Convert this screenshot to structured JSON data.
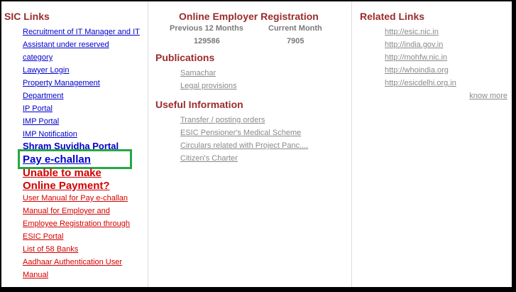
{
  "sic_links": {
    "heading": "SIC Links",
    "lines": [
      {
        "text": "Recruitment of IT Manager and IT",
        "style": "blue"
      },
      {
        "text": "Assistant under reserved",
        "style": "blue"
      },
      {
        "text": "category",
        "style": "blue"
      },
      {
        "text": "Lawyer Login",
        "style": "blue"
      },
      {
        "text": "Property Management",
        "style": "blue"
      },
      {
        "text": "Department",
        "style": "blue"
      },
      {
        "text": "IP Portal",
        "style": "blue"
      },
      {
        "text": "IMP Portal",
        "style": "blue"
      },
      {
        "text": "IMP Notification",
        "style": "blue"
      },
      {
        "text": "Shram Suvidha Portal",
        "style": "big-blue"
      },
      {
        "text": "Pay e-challan",
        "style": "pay"
      },
      {
        "text": "Unable to make",
        "style": "big-red"
      },
      {
        "text": "Online Payment?",
        "style": "big-red"
      },
      {
        "text": "User Manual for Pay e-challan",
        "style": "red"
      },
      {
        "text": "Manual for Employer and",
        "style": "red"
      },
      {
        "text": "Employee Registration through",
        "style": "red"
      },
      {
        "text": "ESIC Portal",
        "style": "red"
      },
      {
        "text": "List of 58 Banks",
        "style": "red"
      },
      {
        "text": "Aadhaar Authentication User",
        "style": "red"
      },
      {
        "text": "Manual",
        "style": "red"
      }
    ]
  },
  "employer_registration": {
    "heading": "Online Employer Registration",
    "prev_label": "Previous 12 Months",
    "curr_label": "Current Month",
    "prev_value": "129586",
    "curr_value": "7905"
  },
  "publications": {
    "heading": "Publications",
    "items": [
      "Samachar",
      "Legal provisions"
    ]
  },
  "useful_info": {
    "heading": "Useful Information",
    "items": [
      "Transfer / posting orders",
      "ESIC Pensioner's Medical Scheme",
      "Circulars related with Project Panc....",
      "Citizen's Charter"
    ]
  },
  "related_links": {
    "heading": "Related Links",
    "items": [
      "http://esic.nic.in",
      "http://india.gov.in",
      "http://mohfw.nic.in",
      "http://whoindia.org",
      "http://esicdelhi.org.in"
    ],
    "more_label": "know more"
  }
}
